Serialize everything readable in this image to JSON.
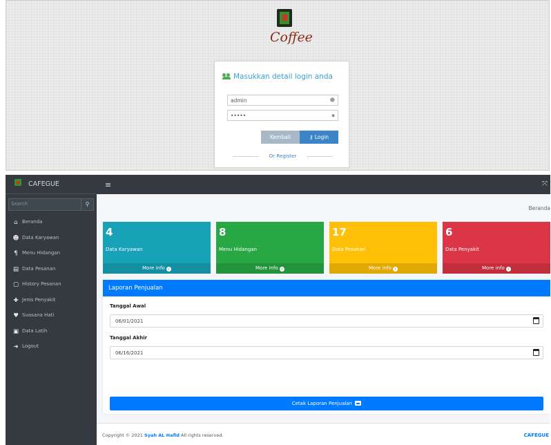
{
  "login": {
    "logo_text": "Coffee",
    "title": "Masukkan detail login anda",
    "username_value": "admin",
    "password_value": "•••••",
    "back_button": "Kembali",
    "login_button": "Login",
    "register_link": "Or Register"
  },
  "app": {
    "brand": "CAFEGUE",
    "search_placeholder": "Search",
    "breadcrumb": "Beranda"
  },
  "sidebar": {
    "items": [
      {
        "label": "Beranda",
        "icon": "home-icon",
        "glyph": "⌂"
      },
      {
        "label": "Data Karyawan",
        "icon": "user-icon",
        "glyph": "☻"
      },
      {
        "label": "Menu Hidangan",
        "icon": "utensils-icon",
        "glyph": "¶"
      },
      {
        "label": "Data Pesanan",
        "icon": "file-icon",
        "glyph": "▤"
      },
      {
        "label": "History Pesanan",
        "icon": "history-icon",
        "glyph": "▢"
      },
      {
        "label": "Jenis Penyakit",
        "icon": "medical-icon",
        "glyph": "✚"
      },
      {
        "label": "Suasana Hati",
        "icon": "heart-icon",
        "glyph": "♥"
      },
      {
        "label": "Data Latih",
        "icon": "chart-icon",
        "glyph": "▣"
      },
      {
        "label": "Logout",
        "icon": "logout-icon",
        "glyph": "➜"
      }
    ]
  },
  "stats": [
    {
      "value": "4",
      "label": "Data Karyawan",
      "more": "More info",
      "color": "#17a2b8"
    },
    {
      "value": "8",
      "label": "Menu Hidangan",
      "more": "More info",
      "color": "#28a745"
    },
    {
      "value": "17",
      "label": "Data Pesanan",
      "more": "More info",
      "color": "#ffc107"
    },
    {
      "value": "6",
      "label": "Data Penyakit",
      "more": "More info",
      "color": "#dc3545"
    }
  ],
  "report": {
    "header": "Laporan Penjualan",
    "start_label": "Tanggal Awal",
    "start_value": "06/01/2021",
    "end_label": "Tanggal Akhir",
    "end_value": "06/16/2021",
    "print_button": "Cetak Laporan Penjualan"
  },
  "footer": {
    "copyright": "Copyright © 2021",
    "author": "Syah AL Hafid",
    "rights": "All rights reserved.",
    "brand": "CAFEGUE"
  }
}
